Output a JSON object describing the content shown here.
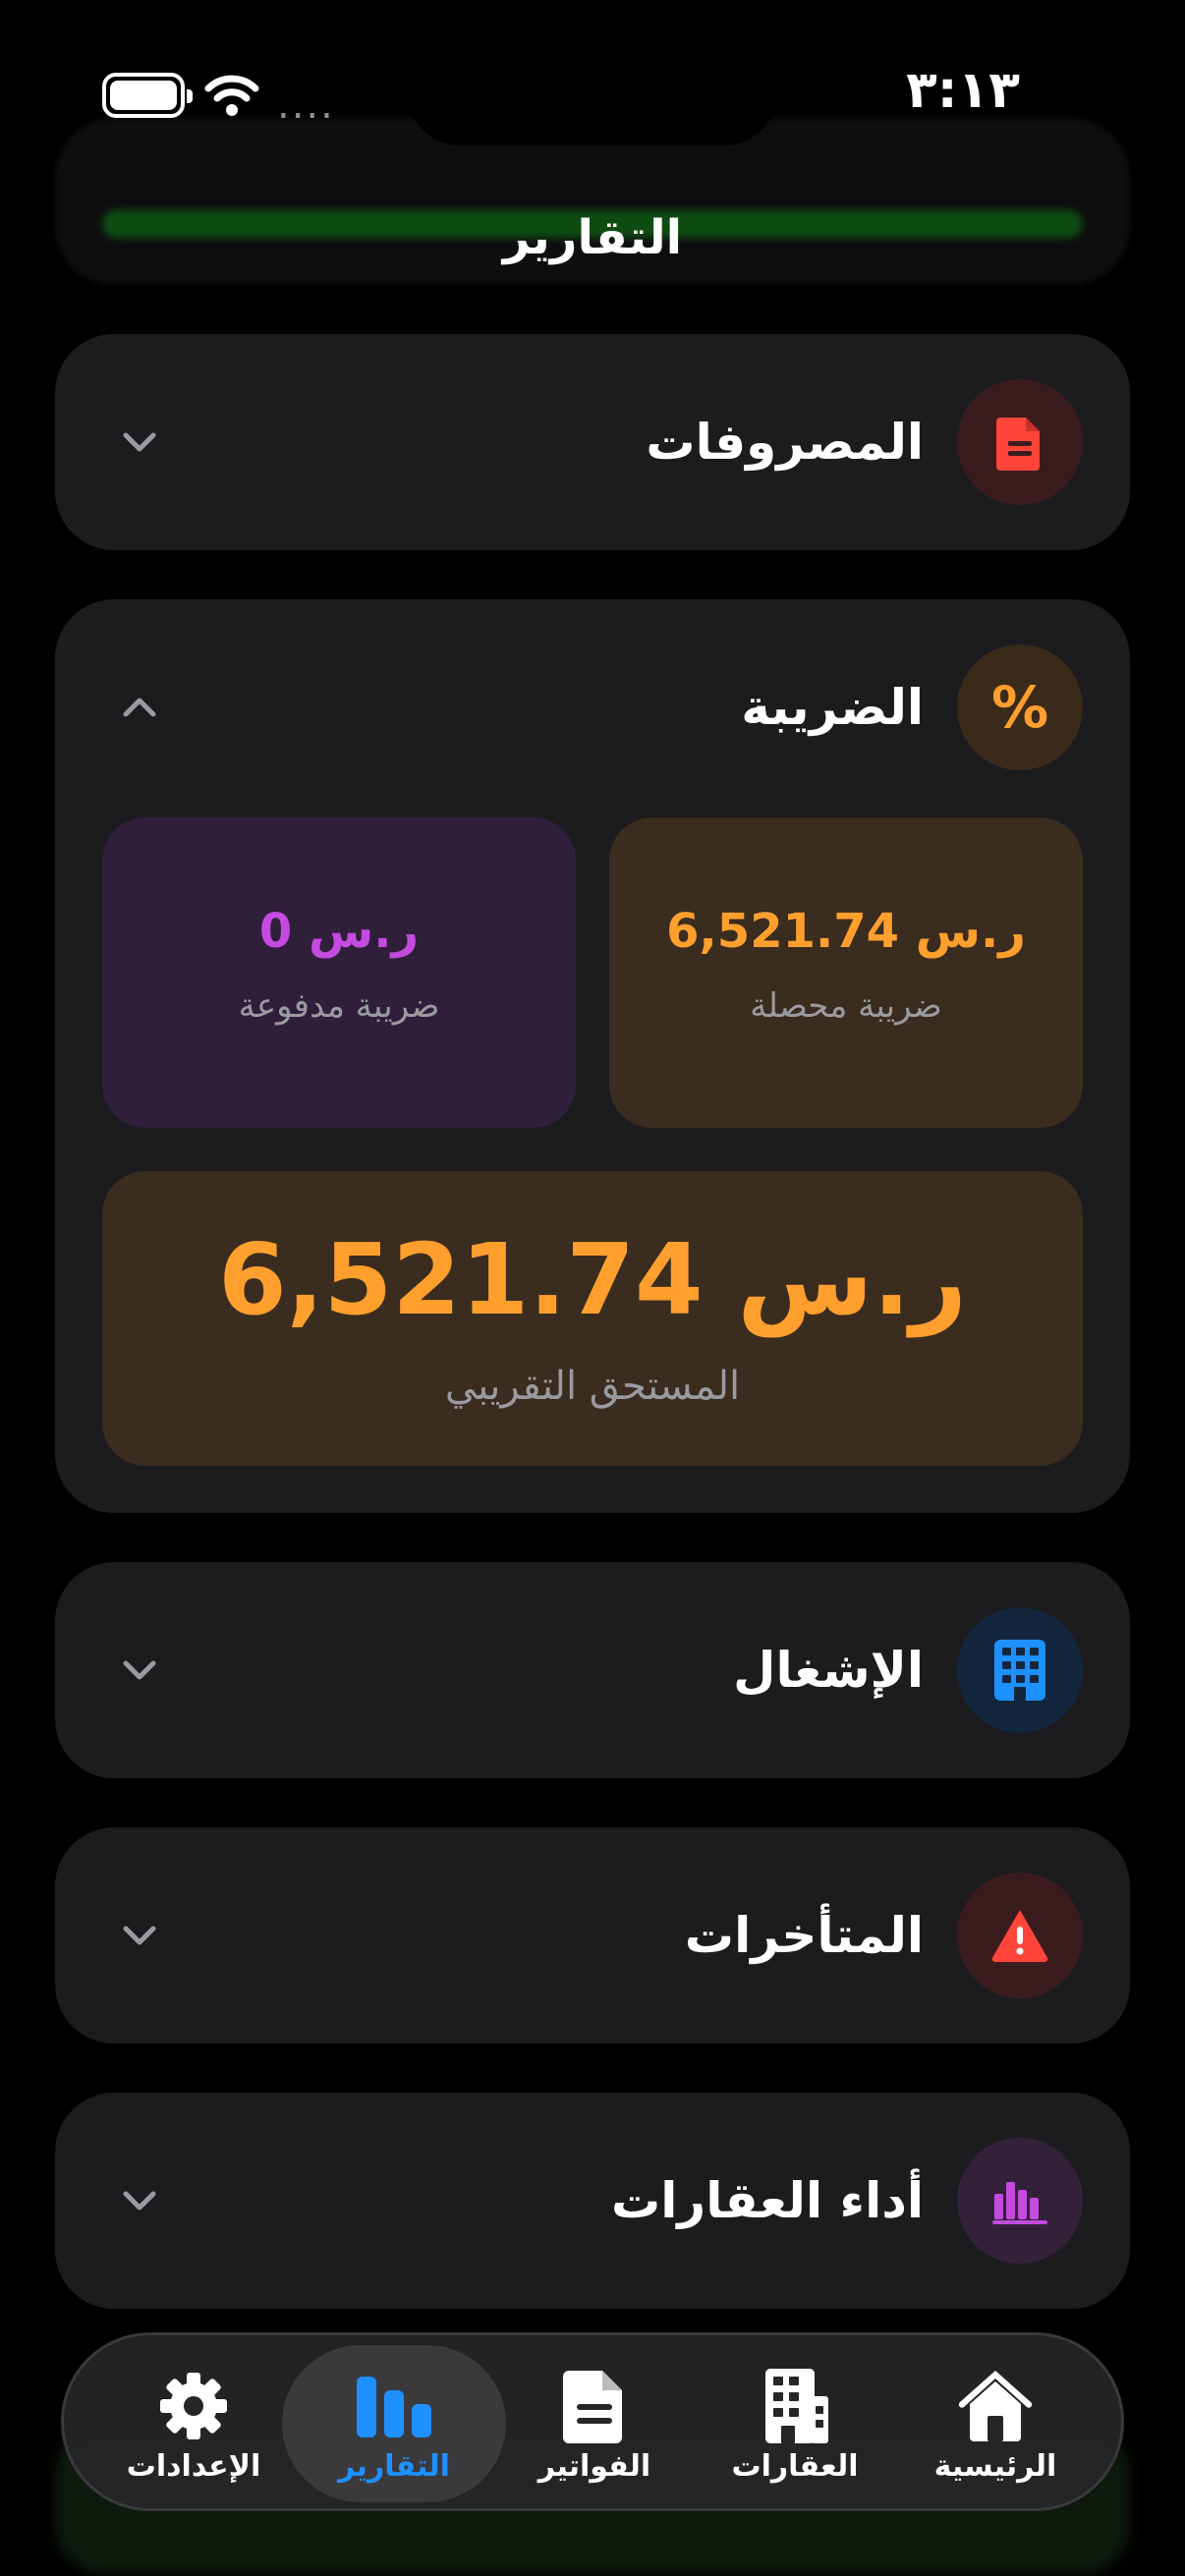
{
  "status_bar": {
    "time": "٣:١٣",
    "signal_dots": "....",
    "battery_level": 1.0
  },
  "page_title": "التقارير",
  "sections": {
    "expenses": {
      "title": "المصروفات",
      "icon": "document-icon",
      "color": "#ff453a",
      "expanded": false
    },
    "tax": {
      "title": "الضريبة",
      "icon_glyph": "%",
      "color": "#ff9f2e",
      "expanded": true,
      "collected_value": "6,521.74 ر.س",
      "collected_label": "ضريبة محصلة",
      "paid_value": "0 ر.س",
      "paid_label": "ضريبة مدفوعة",
      "due_value": "6,521.74 ر.س",
      "due_label": "المستحق التقريبي"
    },
    "occupancy": {
      "title": "الإشغال",
      "icon": "building-icon",
      "color": "#1e90ff",
      "expanded": false
    },
    "overdue": {
      "title": "المتأخرات",
      "icon": "warning-icon",
      "color": "#ff453a",
      "expanded": false
    },
    "property_performance": {
      "title": "أداء العقارات",
      "icon": "bar-chart-icon",
      "color": "#c44ae0",
      "expanded": false
    }
  },
  "colors": {
    "background": "#000000",
    "card": "#1c1c1e",
    "accent_blue": "#1e90ff",
    "orange": "#ff9f2e",
    "purple": "#c44ae0",
    "red": "#ff453a"
  },
  "tabbar": {
    "active": "reports",
    "items": [
      {
        "key": "settings",
        "label": "الإعدادات",
        "icon": "gear-icon"
      },
      {
        "key": "reports",
        "label": "التقارير",
        "icon": "chart-icon"
      },
      {
        "key": "invoices",
        "label": "الفواتير",
        "icon": "document-icon"
      },
      {
        "key": "properties",
        "label": "العقارات",
        "icon": "building-icon"
      },
      {
        "key": "home",
        "label": "الرئيسية",
        "icon": "home-icon"
      }
    ]
  }
}
